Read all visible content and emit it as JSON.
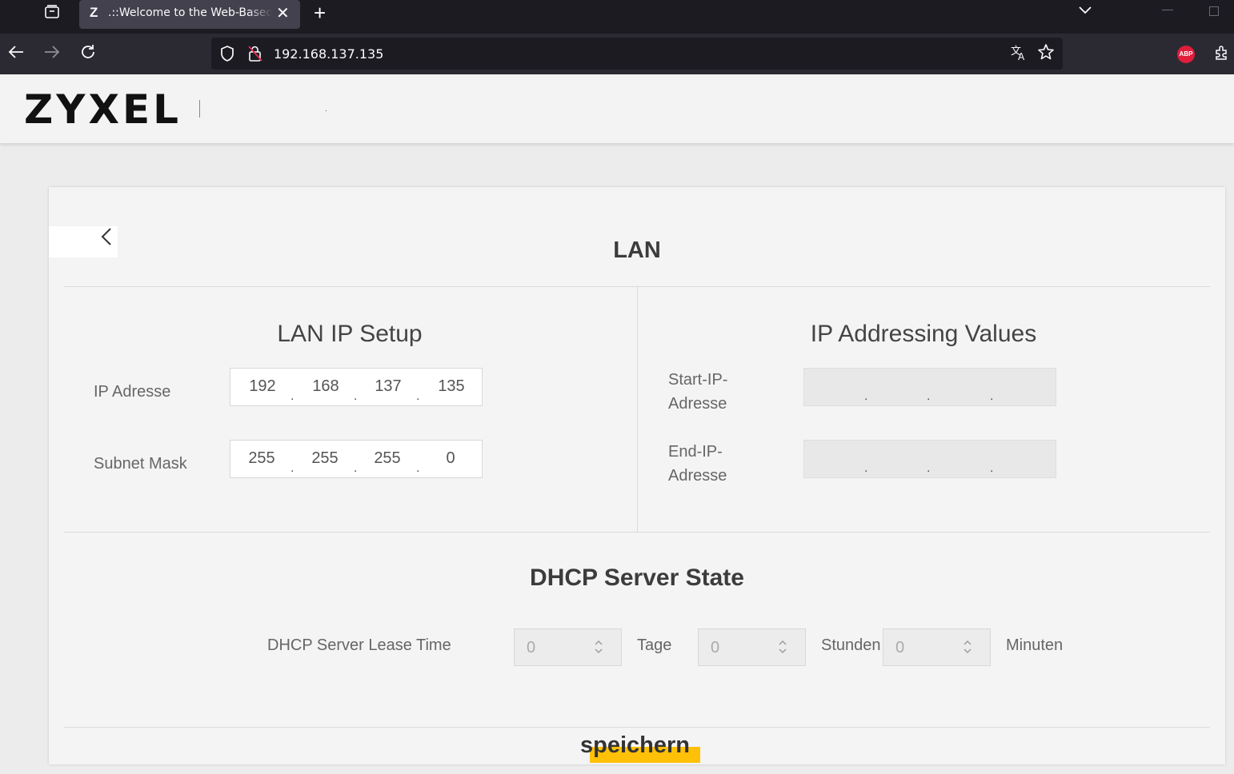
{
  "browser": {
    "tab_favicon": "Z",
    "tab_title": ".::Welcome to the Web-Based Configurator",
    "tab_close": "✕",
    "new_tab": "+",
    "url": "192.168.137.135",
    "extension_abp": "ABP"
  },
  "header": {
    "logo": "ZYXEL"
  },
  "page": {
    "title": "LAN",
    "lan_ip_setup": {
      "heading": "LAN IP Setup",
      "ip_label": "IP Adresse",
      "ip": [
        "192",
        "168",
        "137",
        "135"
      ],
      "subnet_label": "Subnet Mask",
      "subnet": [
        "255",
        "255",
        "255",
        "0"
      ]
    },
    "ip_addressing": {
      "heading": "IP Addressing Values",
      "start_label_line1": "Start-IP-",
      "start_label_line2": "Adresse",
      "start_ip": [
        "",
        "",
        "",
        ""
      ],
      "end_label_line1": "End-IP-",
      "end_label_line2": "Adresse",
      "end_ip": [
        "",
        "",
        "",
        ""
      ]
    },
    "dhcp": {
      "heading": "DHCP Server State",
      "lease_label": "DHCP Server Lease Time",
      "days_value": "0",
      "days_unit": "Tage",
      "hours_value": "0",
      "hours_unit": "Stunden",
      "minutes_value": "0",
      "minutes_unit": "Minuten"
    },
    "save_label": "speichern"
  },
  "colors": {
    "accent": "#ffc107",
    "abp_red": "#e01e3c"
  }
}
